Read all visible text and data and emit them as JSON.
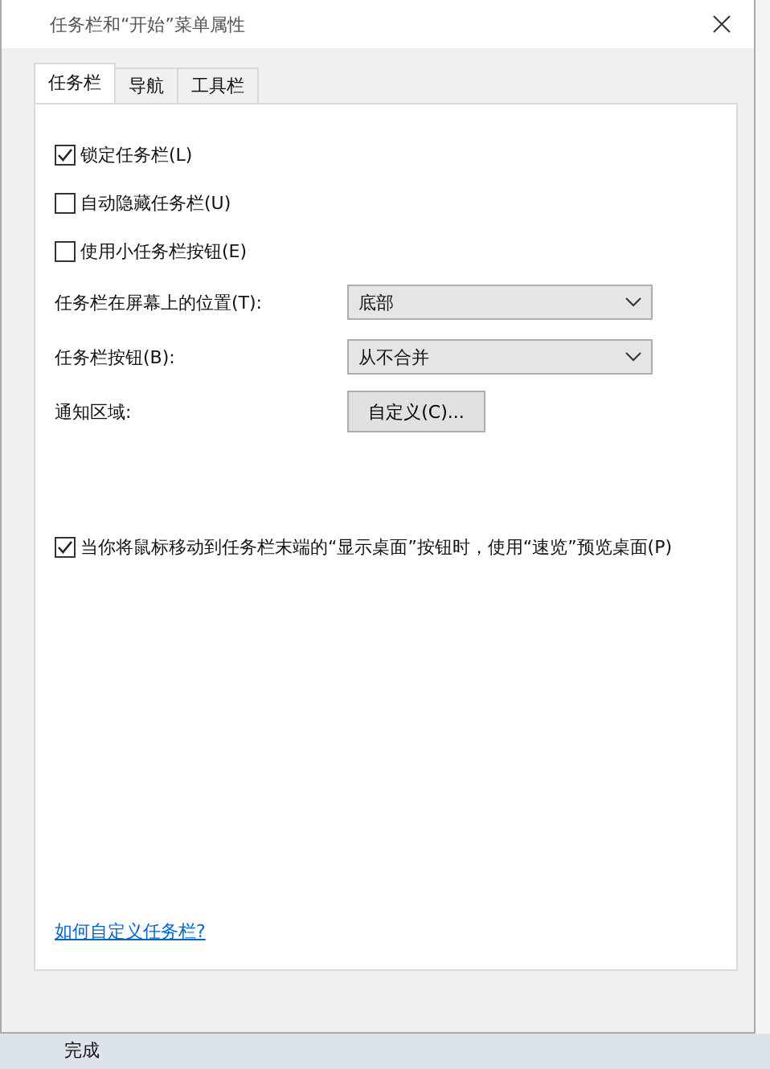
{
  "window": {
    "title": "任务栏和“开始”菜单属性"
  },
  "tabs": [
    {
      "label": "任务栏",
      "selected": true
    },
    {
      "label": "导航",
      "selected": false
    },
    {
      "label": "工具栏",
      "selected": false
    }
  ],
  "options": [
    {
      "kind": "checkbox",
      "label": "锁定任务栏(L)",
      "checked": true
    },
    {
      "kind": "checkbox",
      "label": "自动隐藏任务栏(U)",
      "checked": false
    },
    {
      "kind": "checkbox",
      "label": "使用小任务栏按钮(E)",
      "checked": false
    },
    {
      "kind": "select",
      "label": "任务栏在屏幕上的位置(T):",
      "value": "底部"
    },
    {
      "kind": "select",
      "label": "任务栏按钮(B):",
      "value": "从不合并"
    },
    {
      "kind": "button",
      "label": "通知区域:",
      "value": "自定义(C)..."
    },
    {
      "kind": "gap"
    },
    {
      "kind": "checkbox",
      "label": "当你将鼠标移动到任务栏末端的“显示桌面”按钮时，使用“速览”预览桌面(P)",
      "checked": true
    }
  ],
  "help_link": "如何自定义任务栏?",
  "background_status": "完成"
}
